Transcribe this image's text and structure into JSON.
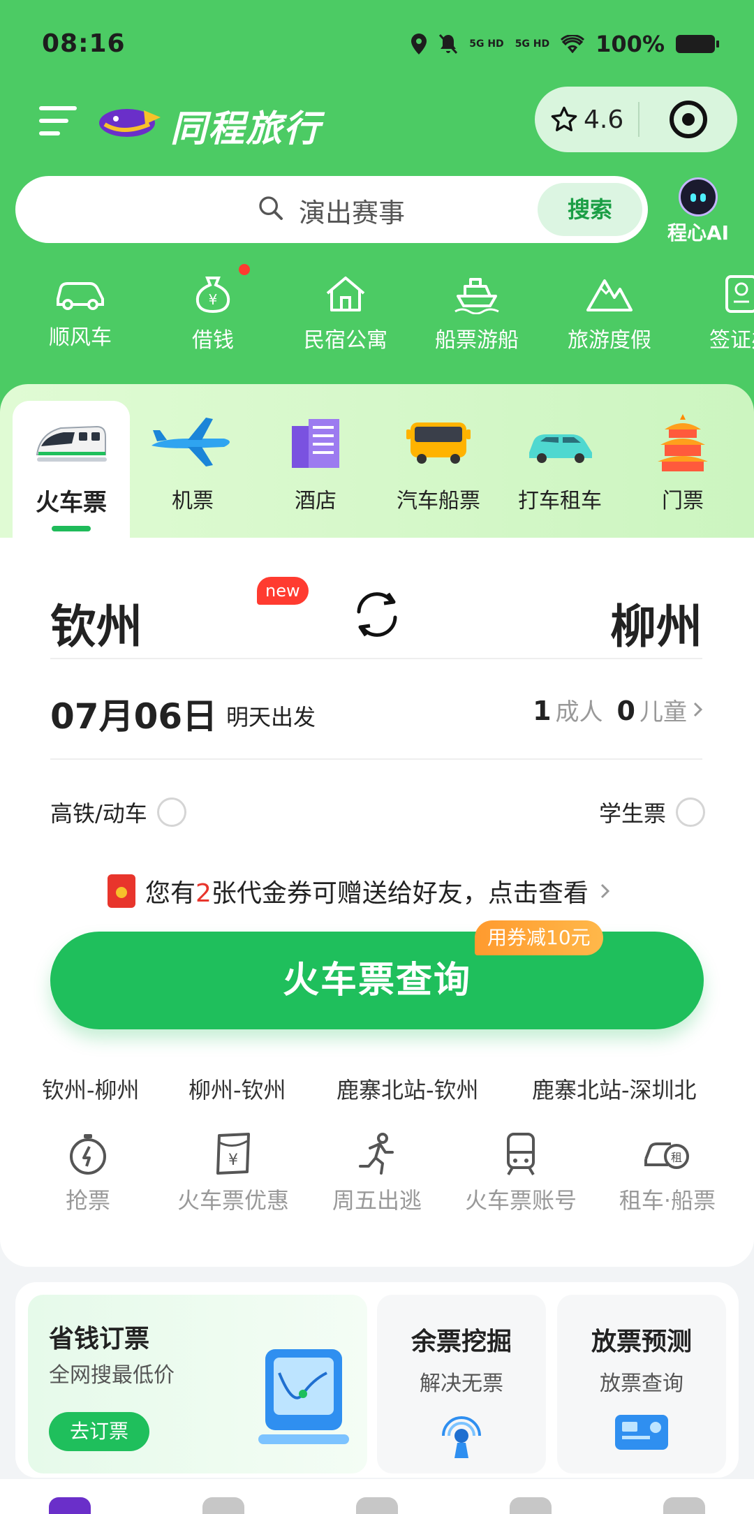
{
  "status": {
    "time": "08:16",
    "sig1": "5G HD",
    "sig2": "5G HD",
    "battery": "100%"
  },
  "header": {
    "brand": "同程旅行",
    "rating": "4.6"
  },
  "search": {
    "placeholder": "演出赛事",
    "button": "搜索"
  },
  "ai": {
    "label": "程心AI"
  },
  "quick": [
    "顺风车",
    "借钱",
    "民宿公寓",
    "船票游船",
    "旅游度假",
    "签证办"
  ],
  "tabs": [
    "火车票",
    "机票",
    "酒店",
    "汽车船票",
    "打车租车",
    "门票"
  ],
  "trip": {
    "from": "钦州",
    "to": "柳州",
    "date": "07月06日",
    "date_note": "明天出发",
    "adults": "1",
    "adults_label": "成人",
    "children": "0",
    "children_label": "儿童"
  },
  "options": {
    "highspeed": "高铁/动车",
    "student": "学生票"
  },
  "coupon": {
    "prefix": "您有",
    "count": "2",
    "suffix": "张代金券可赠送给好友，点击查看"
  },
  "query": {
    "button": "火车票查询",
    "badge": "用券减10元"
  },
  "history": [
    "钦州-柳州",
    "柳州-钦州",
    "鹿寨北站-钦州",
    "鹿寨北站-深圳北"
  ],
  "tools": {
    "items": [
      "抢票",
      "火车票优惠",
      "周五出逃",
      "火车票账号",
      "租车·船票"
    ],
    "new_badge": "new"
  },
  "promo": {
    "card1": {
      "title": "省钱订票",
      "subtitle": "全网搜最低价",
      "button": "去订票"
    },
    "card2": {
      "title": "余票挖掘",
      "subtitle": "解决无票"
    },
    "card3": {
      "title": "放票预测",
      "subtitle": "放票查询"
    }
  },
  "colors": {
    "brand_green": "#4ccb64",
    "primary": "#1fbf5c",
    "accent_orange": "#ff9a2e",
    "alert_red": "#e8352c"
  }
}
